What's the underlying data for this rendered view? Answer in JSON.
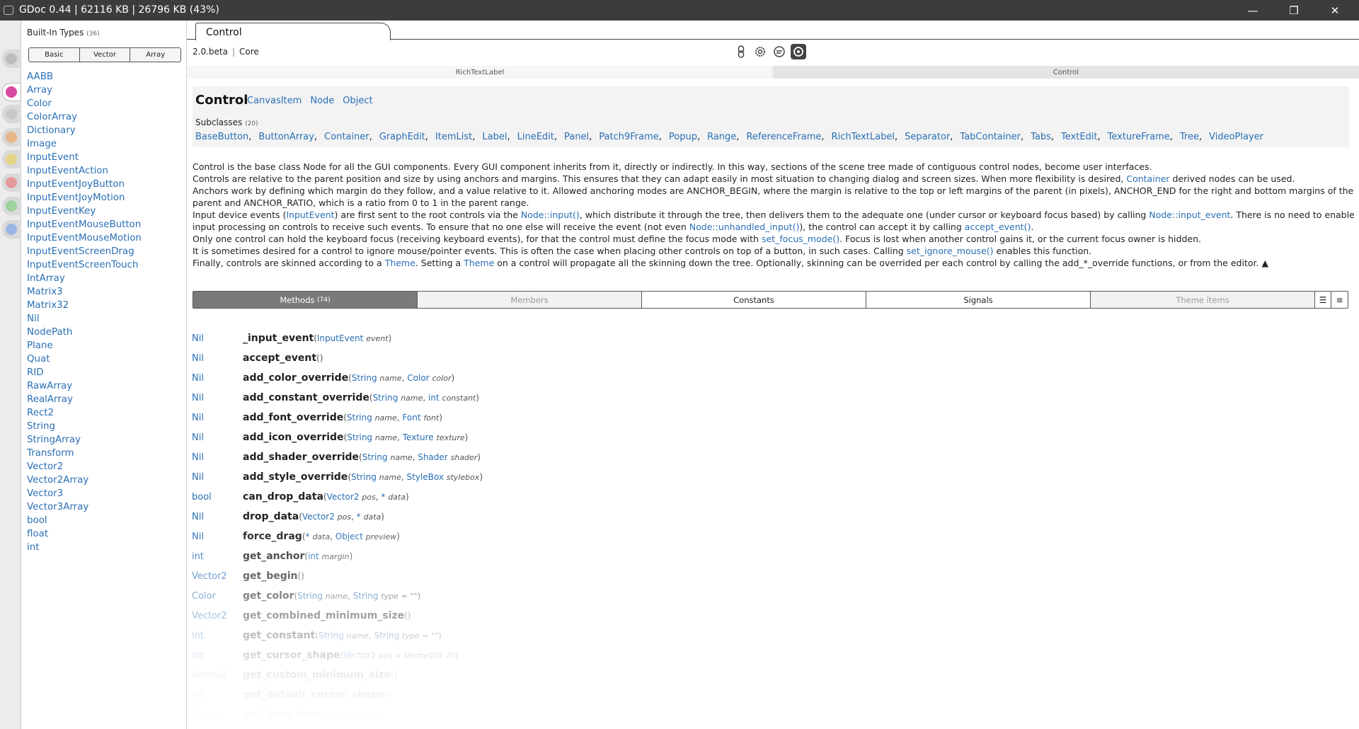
{
  "window": {
    "title": "GDoc 0.44 | 62116 KB | 26796 KB (43%)",
    "minimize": "—",
    "maximize": "❐",
    "close": "✕"
  },
  "left_strip": {
    "tabs": [
      {
        "icon": "gray-tab-icon",
        "color": "#bdbdbd"
      },
      {
        "icon": "pink-godot-icon",
        "color": "#d84aa0"
      },
      {
        "icon": "gray-tab-icon",
        "color": "#c8c8c8"
      },
      {
        "icon": "orange-tab-icon",
        "color": "#e6b58a"
      },
      {
        "icon": "yellow-tab-icon",
        "color": "#e6d38a"
      },
      {
        "icon": "red-tab-icon",
        "color": "#e49a9a"
      },
      {
        "icon": "green-tab-icon",
        "color": "#9ed19e"
      },
      {
        "icon": "blue-tab-icon",
        "color": "#9ab6e4"
      }
    ]
  },
  "sidebar": {
    "header": "Built-In Types",
    "count": "(36)",
    "segments": [
      "Basic",
      "Vector",
      "Array"
    ],
    "types": [
      "AABB",
      "Array",
      "Color",
      "ColorArray",
      "Dictionary",
      "Image",
      "InputEvent",
      "InputEventAction",
      "InputEventJoyButton",
      "InputEventJoyMotion",
      "InputEventKey",
      "InputEventMouseButton",
      "InputEventMouseMotion",
      "InputEventScreenDrag",
      "InputEventScreenTouch",
      "IntArray",
      "Matrix3",
      "Matrix32",
      "Nil",
      "NodePath",
      "Plane",
      "Quat",
      "RID",
      "RawArray",
      "RealArray",
      "Rect2",
      "String",
      "StringArray",
      "Transform",
      "Vector2",
      "Vector2Array",
      "Vector3",
      "Vector3Array",
      "bool",
      "float",
      "int"
    ]
  },
  "doc_tab": "Control",
  "breadcrumb": {
    "version": "2.0.beta",
    "separator": "|",
    "module": "Core"
  },
  "pathbar": [
    "RichTextLabel",
    "Control"
  ],
  "class": {
    "name": "Control",
    "inherits": [
      "CanvasItem",
      "Node",
      "Object"
    ],
    "subclasses_label": "Subclasses",
    "subclasses_count": "(20)",
    "subclasses": [
      "BaseButton",
      "ButtonArray",
      "Container",
      "GraphEdit",
      "ItemList",
      "Label",
      "LineEdit",
      "Panel",
      "Patch9Frame",
      "Popup",
      "Range",
      "ReferenceFrame",
      "RichTextLabel",
      "Separator",
      "TabContainer",
      "Tabs",
      "TextEdit",
      "TextureFrame",
      "Tree",
      "VideoPlayer"
    ]
  },
  "description": {
    "l1": "Control is the base class Node for all the GUI components. Every GUI component inherits from it, directly or indirectly. In this way, sections of the scene tree made of contiguous control nodes, become user interfaces.",
    "l2a": "Controls are relative to the parent position and size by using anchors and margins. This ensures that they can adapt easily in most situation to changing dialog and screen sizes. When more flexibility is desired,",
    "l2link": "Container",
    "l2b": "derived nodes can be used.",
    "l3": "Anchors work by defining which margin do they follow, and a value relative to it. Allowed anchoring modes are ANCHOR_BEGIN, where the margin is relative to the top or left margins of the parent (in pixels), ANCHOR_END for the right and bottom margins of the",
    "l4": "parent and ANCHOR_RATIO, which is a ratio from 0 to 1 in the parent range.",
    "l5a": "Input device events (",
    "l5link1": "InputEvent",
    "l5b": ") are first sent to the root controls via the",
    "l5link2": "Node::input()",
    "l5c": ", which distribute it through the tree, then delivers them to the adequate one (under cursor or keyboard focus based) by calling",
    "l5link3": "Node::input_event",
    "l5d": ". There is no need to enable",
    "l6a": "input processing on controls to receive such events. To ensure that no one else will receive the event (not even",
    "l6link1": "Node::unhandled_input()",
    "l6b": "), the control can accept it by calling",
    "l6link2": "accept_event()",
    "l6c": ".",
    "l7a": "Only one control can hold the keyboard focus (receiving keyboard events), for that the control must define the focus mode with",
    "l7link": "set_focus_mode()",
    "l7b": ". Focus is lost when another control gains it, or the current focus owner is hidden.",
    "l8a": "It is sometimes desired for a control to ignore mouse/pointer events. This is often the case when placing other controls on top of a button, in such cases. Calling",
    "l8link": "set_ignore_mouse()",
    "l8b": "enables this function.",
    "l9a": "Finally, controls are skinned according to a",
    "l9link1": "Theme",
    "l9b": ". Setting a",
    "l9link2": "Theme",
    "l9c": "on a control will propagate all the skinning down the tree. Optionally, skinning can be overrided per each control by calling the add_*_override functions, or from the editor.",
    "collapse": "▲"
  },
  "section_tabs": {
    "methods": "Methods",
    "methods_count": "(74)",
    "members": "Members",
    "constants": "Constants",
    "signals": "Signals",
    "theme_items": "Theme items"
  },
  "methods": [
    {
      "ret": "Nil",
      "name": "_input_event",
      "args": [
        {
          "type": "InputEvent",
          "name": "event"
        }
      ]
    },
    {
      "ret": "Nil",
      "name": "accept_event",
      "args": []
    },
    {
      "ret": "Nil",
      "name": "add_color_override",
      "args": [
        {
          "type": "String",
          "name": "name"
        },
        {
          "type": "Color",
          "name": "color"
        }
      ]
    },
    {
      "ret": "Nil",
      "name": "add_constant_override",
      "args": [
        {
          "type": "String",
          "name": "name"
        },
        {
          "type": "int",
          "name": "constant"
        }
      ]
    },
    {
      "ret": "Nil",
      "name": "add_font_override",
      "args": [
        {
          "type": "String",
          "name": "name"
        },
        {
          "type": "Font",
          "name": "font"
        }
      ]
    },
    {
      "ret": "Nil",
      "name": "add_icon_override",
      "args": [
        {
          "type": "String",
          "name": "name"
        },
        {
          "type": "Texture",
          "name": "texture"
        }
      ]
    },
    {
      "ret": "Nil",
      "name": "add_shader_override",
      "args": [
        {
          "type": "String",
          "name": "name"
        },
        {
          "type": "Shader",
          "name": "shader"
        }
      ]
    },
    {
      "ret": "Nil",
      "name": "add_style_override",
      "args": [
        {
          "type": "String",
          "name": "name"
        },
        {
          "type": "StyleBox",
          "name": "stylebox"
        }
      ]
    },
    {
      "ret": "bool",
      "name": "can_drop_data",
      "args": [
        {
          "type": "Vector2",
          "name": "pos"
        },
        {
          "type": "*",
          "name": "data"
        }
      ]
    },
    {
      "ret": "Nil",
      "name": "drop_data",
      "args": [
        {
          "type": "Vector2",
          "name": "pos"
        },
        {
          "type": "*",
          "name": "data"
        }
      ]
    },
    {
      "ret": "Nil",
      "name": "force_drag",
      "args": [
        {
          "type": "*",
          "name": "data"
        },
        {
          "type": "Object",
          "name": "preview"
        }
      ]
    },
    {
      "ret": "int",
      "name": "get_anchor",
      "args": [
        {
          "type": "int",
          "name": "margin"
        }
      ]
    },
    {
      "ret": "Vector2",
      "name": "get_begin",
      "args": []
    },
    {
      "ret": "Color",
      "name": "get_color",
      "args": [
        {
          "type": "String",
          "name": "name"
        },
        {
          "type": "String",
          "name": "type",
          "default": "= \"\""
        }
      ]
    },
    {
      "ret": "Vector2",
      "name": "get_combined_minimum_size",
      "args": []
    },
    {
      "ret": "int",
      "name": "get_constant",
      "args": [
        {
          "type": "String",
          "name": "name"
        },
        {
          "type": "String",
          "name": "type",
          "default": "= \"\""
        }
      ]
    },
    {
      "ret": "int",
      "name": "get_cursor_shape",
      "args": [
        {
          "type": "Vector2",
          "name": "pos",
          "default": "= Vector2(0, 0)"
        }
      ]
    },
    {
      "ret": "Vector2",
      "name": "get_custom_minimum_size",
      "args": []
    },
    {
      "ret": "int",
      "name": "get_default_cursor_shape",
      "args": []
    },
    {
      "ret": "Object",
      "name": "get_drag_data",
      "args": [
        {
          "type": "Vector2",
          "name": "pos"
        }
      ]
    }
  ]
}
